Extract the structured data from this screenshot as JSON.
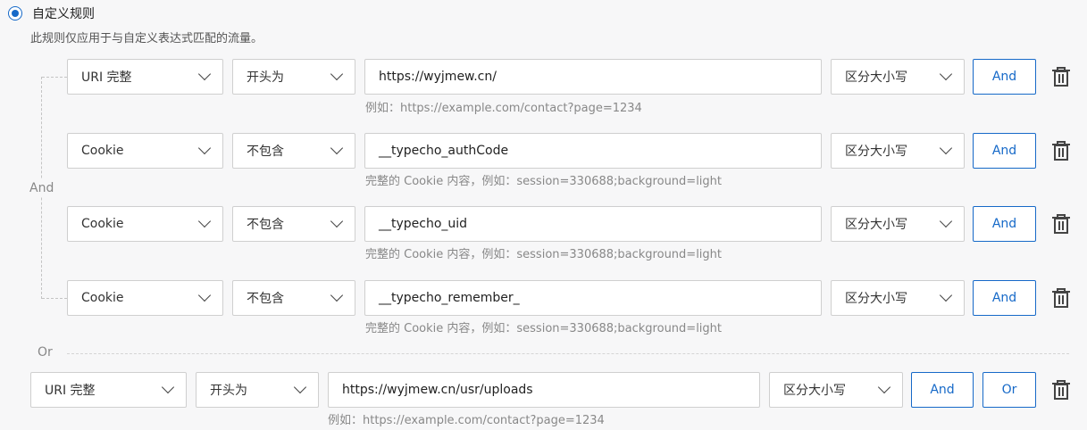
{
  "header": {
    "radio_label": "自定义规则",
    "description": "此规则仅应用于与自定义表达式匹配的流量。"
  },
  "group_connector_label": "And",
  "or_divider_label": "Or",
  "rules": [
    {
      "field": "URI 完整",
      "operator": "开头为",
      "value": "https://wyjmew.cn/",
      "case": "区分大小写",
      "and_label": "And",
      "hint": "例如：https://example.com/contact?page=1234"
    },
    {
      "field": "Cookie",
      "operator": "不包含",
      "value": "__typecho_authCode",
      "case": "区分大小写",
      "and_label": "And",
      "hint": "完整的 Cookie 内容，例如：session=330688;background=light"
    },
    {
      "field": "Cookie",
      "operator": "不包含",
      "value": "__typecho_uid",
      "case": "区分大小写",
      "and_label": "And",
      "hint": "完整的 Cookie 内容，例如：session=330688;background=light"
    },
    {
      "field": "Cookie",
      "operator": "不包含",
      "value": "__typecho_remember_",
      "case": "区分大小写",
      "and_label": "And",
      "hint": "完整的 Cookie 内容，例如：session=330688;background=light"
    }
  ],
  "or_rule": {
    "field": "URI 完整",
    "operator": "开头为",
    "value": "https://wyjmew.cn/usr/uploads",
    "case": "区分大小写",
    "and_label": "And",
    "or_label": "Or",
    "hint": "例如：https://example.com/contact?page=1234"
  },
  "icons": {
    "radio": "radio-selected-icon",
    "dropdown": "chevron-down-icon",
    "delete": "trash-icon"
  },
  "colors": {
    "accent": "#1669c8",
    "border": "#cfcfcf",
    "hint": "#888888",
    "background": "#f7f7f8"
  }
}
